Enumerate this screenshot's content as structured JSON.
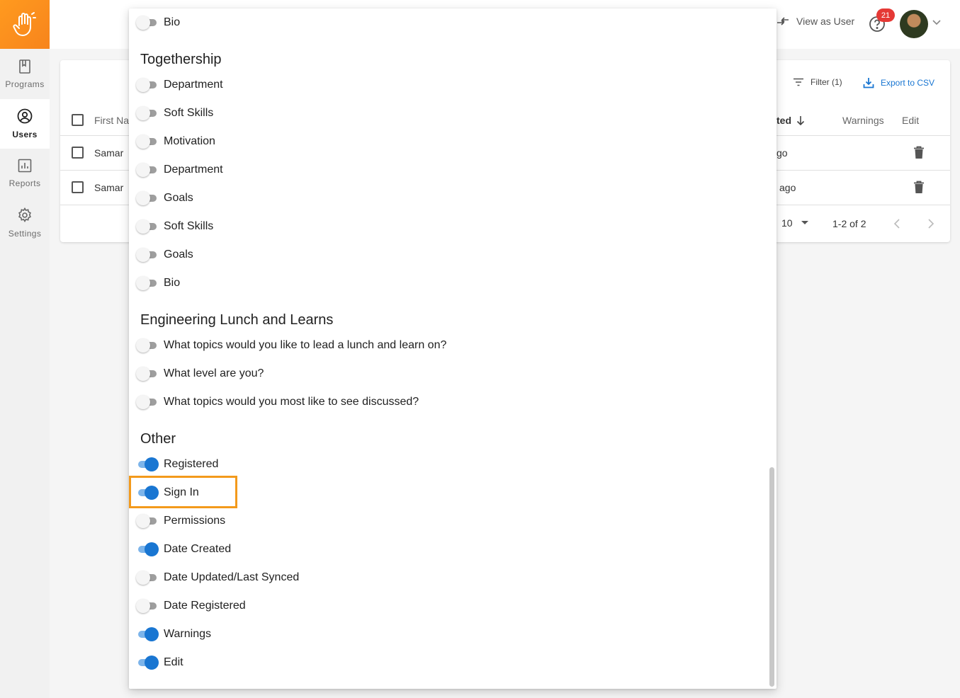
{
  "sidebar": {
    "logo_icon": "hand-wave-icon",
    "items": [
      {
        "label": "Programs",
        "icon": "bookmark-icon",
        "active": false
      },
      {
        "label": "Users",
        "icon": "user-circle-icon",
        "active": true
      },
      {
        "label": "Reports",
        "icon": "bar-chart-icon",
        "active": false
      },
      {
        "label": "Settings",
        "icon": "gear-icon",
        "active": false
      }
    ]
  },
  "header": {
    "view_as_user": "View as User",
    "notification_count": "21"
  },
  "toolbar": {
    "filter_label": "Filter (1)",
    "export_label": "Export to CSV"
  },
  "table": {
    "headers": {
      "first_name": "First Na",
      "date_created": "ted",
      "warnings": "Warnings",
      "edit": "Edit"
    },
    "rows": [
      {
        "first_name": "Samar",
        "date_created": "go"
      },
      {
        "first_name": "Samar",
        "date_created": "ago"
      }
    ],
    "pagination": {
      "rows_per_page": "10",
      "range": "1-2 of 2"
    }
  },
  "column_picker": {
    "top_items": [
      {
        "label": "Bio",
        "on": false
      }
    ],
    "sections": [
      {
        "title": "Togethership",
        "items": [
          {
            "label": "Department",
            "on": false
          },
          {
            "label": "Soft Skills",
            "on": false
          },
          {
            "label": "Motivation",
            "on": false
          },
          {
            "label": "Department",
            "on": false
          },
          {
            "label": "Goals",
            "on": false
          },
          {
            "label": "Soft Skills",
            "on": false
          },
          {
            "label": "Goals",
            "on": false
          },
          {
            "label": "Bio",
            "on": false
          }
        ]
      },
      {
        "title": "Engineering Lunch and Learns",
        "items": [
          {
            "label": "What topics would you like to lead a lunch and learn on?",
            "on": false
          },
          {
            "label": "What level are you?",
            "on": false
          },
          {
            "label": "What topics would you most like to see discussed?",
            "on": false
          }
        ]
      },
      {
        "title": "Other",
        "items": [
          {
            "label": "Registered",
            "on": true
          },
          {
            "label": "Sign In",
            "on": true
          },
          {
            "label": "Permissions",
            "on": false
          },
          {
            "label": "Date Created",
            "on": true
          },
          {
            "label": "Date Updated/Last Synced",
            "on": false
          },
          {
            "label": "Date Registered",
            "on": false
          },
          {
            "label": "Warnings",
            "on": true
          },
          {
            "label": "Edit",
            "on": true
          }
        ]
      }
    ]
  },
  "colors": {
    "brand_orange": "#f7841c",
    "toggle_on": "#1976d2",
    "highlight": "#f39a1c",
    "badge": "#e53935"
  }
}
